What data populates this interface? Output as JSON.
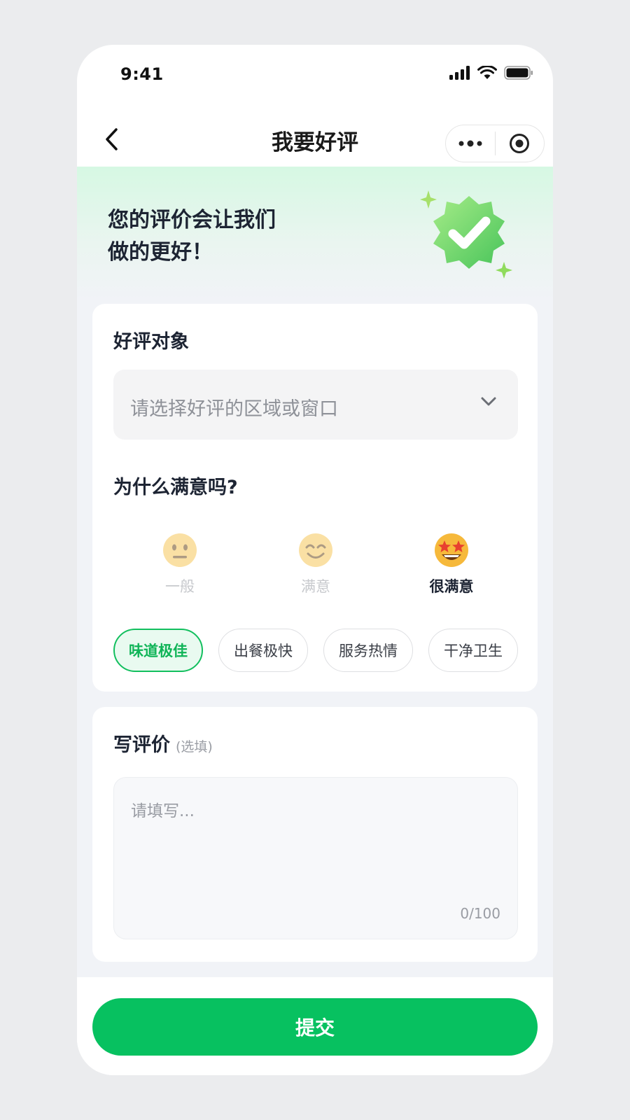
{
  "status_bar": {
    "time": "9:41"
  },
  "nav": {
    "title": "我要好评"
  },
  "hero": {
    "line1": "您的评价会让我们",
    "line2": "做的更好！"
  },
  "target_section": {
    "label": "好评对象",
    "select_placeholder": "请选择好评的区域或窗口"
  },
  "rating_section": {
    "label": "为什么满意吗?",
    "options": [
      {
        "label": "一般",
        "icon": "neutral-face-icon",
        "active": false
      },
      {
        "label": "满意",
        "icon": "smiling-face-icon",
        "active": false
      },
      {
        "label": "很满意",
        "icon": "star-struck-face-icon",
        "active": true
      }
    ]
  },
  "tags": [
    {
      "label": "味道极佳",
      "selected": true
    },
    {
      "label": "出餐极快",
      "selected": false
    },
    {
      "label": "服务热情",
      "selected": false
    },
    {
      "label": "干净卫生",
      "selected": false
    }
  ],
  "review_section": {
    "label": "写评价",
    "optional": "(选填)",
    "placeholder": "请填写...",
    "counter": "0/100"
  },
  "submit": {
    "label": "提交"
  },
  "colors": {
    "accent": "#07c160",
    "tag_selected_text": "#0fb457",
    "page_bg": "#f1f3f7"
  }
}
